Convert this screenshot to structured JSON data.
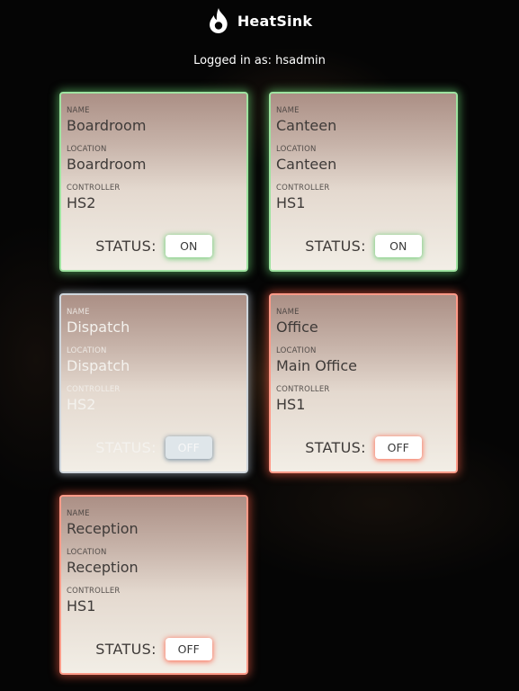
{
  "app": {
    "brand": "HeatSink",
    "logo_icon": "flame-icon"
  },
  "session": {
    "logged_in_text": "Logged in as: hsadmin"
  },
  "labels": {
    "name": "NAME",
    "location": "LOCATION",
    "controller": "CONTROLLER",
    "status": "STATUS:"
  },
  "colors": {
    "on_glow": "#6edc78",
    "off_glow": "#ff5f46",
    "disabled_glow": "#c8d7e6",
    "background": "#050505"
  },
  "devices": [
    {
      "name": "Boardroom",
      "location": "Boardroom",
      "controller": "HS2",
      "status": "ON",
      "state": "on"
    },
    {
      "name": "Canteen",
      "location": "Canteen",
      "controller": "HS1",
      "status": "ON",
      "state": "on"
    },
    {
      "name": "Dispatch",
      "location": "Dispatch",
      "controller": "HS2",
      "status": "OFF",
      "state": "disabled"
    },
    {
      "name": "Office",
      "location": "Main Office",
      "controller": "HS1",
      "status": "OFF",
      "state": "off"
    },
    {
      "name": "Reception",
      "location": "Reception",
      "controller": "HS1",
      "status": "OFF",
      "state": "off"
    }
  ]
}
